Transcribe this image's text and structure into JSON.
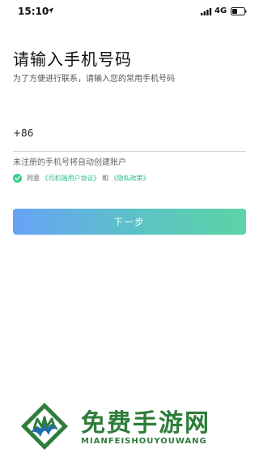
{
  "status_bar": {
    "time": "15:10",
    "network": "4G",
    "icons": [
      "location-arrow-icon",
      "signal-bars-icon",
      "battery-icon"
    ]
  },
  "login": {
    "title": "请输入手机号码",
    "subtitle": "为了方便进行联系，请输入您的常用手机号码",
    "country_code": "+86",
    "phone_value": "",
    "phone_placeholder": "",
    "auto_register_note": "未注册的手机号将自动创建账户",
    "agreement": {
      "checked": true,
      "prefix": "同意",
      "user_agreement": "《司机端用户协议》",
      "conjunction": "和",
      "privacy_policy": "《隐私政策》"
    },
    "next_button": "下一步"
  },
  "watermark": {
    "title": "免费手游网",
    "subtitle": "MIANFEISHOUYOUWANG"
  },
  "colors": {
    "accent_green": "#3ccf8e",
    "link_green": "#2ec08a",
    "button_gradient_start": "#66a3f6",
    "button_gradient_end": "#5bd4a5",
    "watermark_green": "#2e7d3a"
  }
}
